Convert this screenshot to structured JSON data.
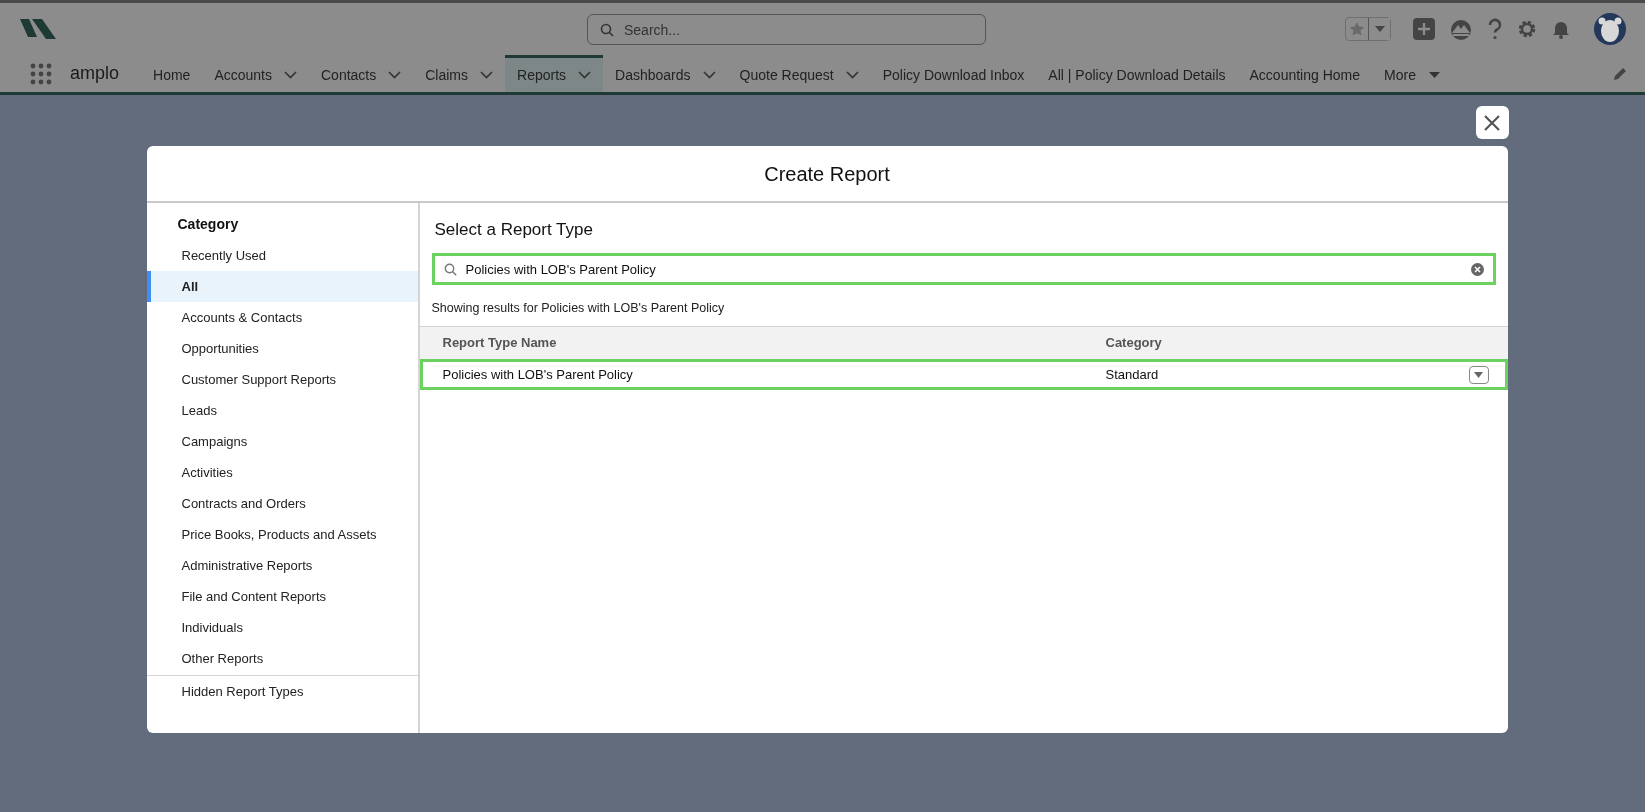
{
  "header": {
    "search": {
      "placeholder": "Search..."
    },
    "app_name": "amplo",
    "nav": [
      {
        "label": "Home",
        "kind": "plain",
        "selected": false
      },
      {
        "label": "Accounts",
        "kind": "dropdown",
        "selected": false
      },
      {
        "label": "Contacts",
        "kind": "dropdown",
        "selected": false
      },
      {
        "label": "Claims",
        "kind": "dropdown",
        "selected": false
      },
      {
        "label": "Reports",
        "kind": "dropdown",
        "selected": true
      },
      {
        "label": "Dashboards",
        "kind": "dropdown",
        "selected": false
      },
      {
        "label": "Quote Request",
        "kind": "dropdown",
        "selected": false
      },
      {
        "label": "Policy Download Inbox",
        "kind": "plain",
        "selected": false
      },
      {
        "label": "All | Policy Download Details",
        "kind": "plain",
        "selected": false
      },
      {
        "label": "Accounting Home",
        "kind": "plain",
        "selected": false
      },
      {
        "label": "More",
        "kind": "overflow",
        "selected": false
      }
    ]
  },
  "modal": {
    "title": "Create Report",
    "sidebar": {
      "heading": "Category",
      "items": [
        {
          "label": "Recently Used",
          "selected": false
        },
        {
          "label": "All",
          "selected": true
        },
        {
          "label": "Accounts & Contacts",
          "selected": false
        },
        {
          "label": "Opportunities",
          "selected": false
        },
        {
          "label": "Customer Support Reports",
          "selected": false
        },
        {
          "label": "Leads",
          "selected": false
        },
        {
          "label": "Campaigns",
          "selected": false
        },
        {
          "label": "Activities",
          "selected": false
        },
        {
          "label": "Contracts and Orders",
          "selected": false
        },
        {
          "label": "Price Books, Products and Assets",
          "selected": false
        },
        {
          "label": "Administrative Reports",
          "selected": false
        },
        {
          "label": "File and Content Reports",
          "selected": false
        },
        {
          "label": "Individuals",
          "selected": false
        },
        {
          "label": "Other Reports",
          "selected": false
        }
      ],
      "footer_items": [
        {
          "label": "Hidden Report Types",
          "selected": false
        }
      ]
    },
    "main": {
      "heading": "Select a Report Type",
      "search": {
        "value": "Policies with LOB's Parent Policy",
        "highlighted": true
      },
      "results_text": "Showing results for Policies with LOB's Parent Policy",
      "table": {
        "columns": [
          "Report Type Name",
          "Category"
        ],
        "rows": [
          {
            "name": "Policies with LOB's Parent Policy",
            "category": "Standard",
            "highlighted": true
          }
        ]
      }
    }
  }
}
